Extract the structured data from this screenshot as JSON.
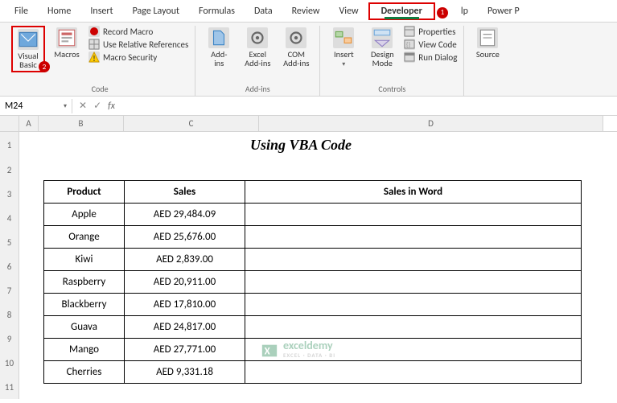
{
  "tabs": {
    "file": "File",
    "home": "Home",
    "insert": "Insert",
    "page_layout": "Page Layout",
    "formulas": "Formulas",
    "data": "Data",
    "review": "Review",
    "view": "View",
    "developer": "Developer",
    "help": "lp",
    "powerp": "Power P"
  },
  "ribbon": {
    "code": {
      "visual_basic": "Visual\nBasic",
      "macros": "Macros",
      "record_macro": "Record Macro",
      "use_relative": "Use Relative References",
      "macro_security": "Macro Security",
      "group_label": "Code"
    },
    "addins": {
      "addins": "Add-\nins",
      "excel_addins": "Excel\nAdd-ins",
      "com_addins": "COM\nAdd-ins",
      "group_label": "Add-ins"
    },
    "controls": {
      "insert": "Insert",
      "design_mode": "Design\nMode",
      "properties": "Properties",
      "view_code": "View Code",
      "run_dialog": "Run Dialog",
      "group_label": "Controls"
    },
    "xml": {
      "source": "Source"
    }
  },
  "formula_bar": {
    "name_box": "M24",
    "cancel": "✕",
    "confirm": "✓",
    "fx": "fx"
  },
  "columns": [
    "A",
    "B",
    "C",
    "D"
  ],
  "row_numbers": [
    "1",
    "2",
    "3",
    "4",
    "5",
    "6",
    "7",
    "8",
    "9",
    "10",
    "11"
  ],
  "sheet": {
    "title": "Using VBA Code",
    "headers": {
      "product": "Product",
      "sales": "Sales",
      "sales_word": "Sales in Word"
    },
    "rows": [
      {
        "product": "Apple",
        "sales": "AED 29,484.09",
        "word": ""
      },
      {
        "product": "Orange",
        "sales": "AED 25,676.00",
        "word": ""
      },
      {
        "product": "Kiwi",
        "sales": "AED 2,839.00",
        "word": ""
      },
      {
        "product": "Raspberry",
        "sales": "AED 20,911.00",
        "word": ""
      },
      {
        "product": "Blackberry",
        "sales": "AED 17,810.00",
        "word": ""
      },
      {
        "product": "Guava",
        "sales": "AED 24,817.00",
        "word": ""
      },
      {
        "product": "Mango",
        "sales": "AED 27,771.00",
        "word": ""
      },
      {
        "product": "Cherries",
        "sales": "AED 9,331.18",
        "word": ""
      }
    ]
  },
  "watermark": {
    "name": "exceldemy",
    "tag": "EXCEL · DATA · BI"
  },
  "callouts": {
    "one": "1",
    "two": "2"
  },
  "col_widths": {
    "A": 24,
    "B": 106,
    "C": 168,
    "D": 428
  }
}
